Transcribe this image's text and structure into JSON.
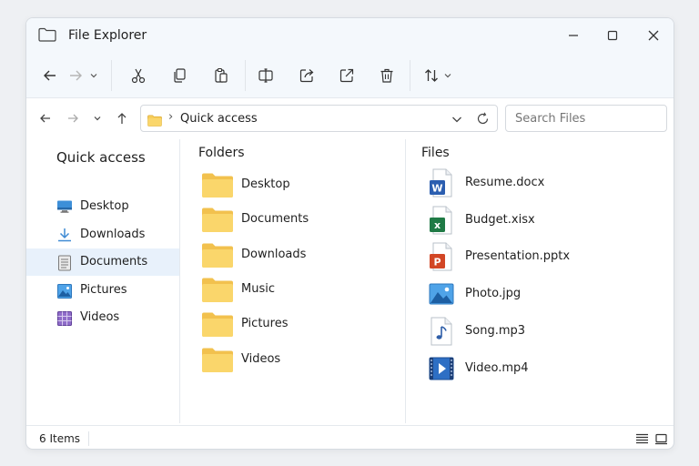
{
  "window": {
    "title": "File Explorer"
  },
  "address": {
    "crumb": "Quick access"
  },
  "search": {
    "placeholder": "Search Files"
  },
  "sidebar": {
    "heading": "Quick access",
    "items": [
      {
        "label": "Desktop",
        "icon": "desktop-icon"
      },
      {
        "label": "Downloads",
        "icon": "download-icon"
      },
      {
        "label": "Documents",
        "icon": "document-icon",
        "selected": true
      },
      {
        "label": "Pictures",
        "icon": "picture-icon"
      },
      {
        "label": "Videos",
        "icon": "video-icon"
      }
    ]
  },
  "folders": {
    "title": "Folders",
    "items": [
      "Desktop",
      "Documents",
      "Downloads",
      "Music",
      "Pictures",
      "Videos"
    ]
  },
  "files": {
    "title": "Files",
    "items": [
      {
        "label": "Resume.docx",
        "icon": "word-icon",
        "badge": "W"
      },
      {
        "label": "Budget.xisx",
        "icon": "excel-icon",
        "badge": "x"
      },
      {
        "label": "Presentation.pptx",
        "icon": "powerpoint-icon",
        "badge": "P"
      },
      {
        "label": "Photo.jpg",
        "icon": "image-icon"
      },
      {
        "label": "Song.mp3",
        "icon": "audio-icon"
      },
      {
        "label": "Video.mp4",
        "icon": "video-file-icon"
      }
    ]
  },
  "status": {
    "count": "6 Items"
  },
  "colors": {
    "accent": "#2f7fd6",
    "folder": "#f7cd5a",
    "word": "#2b5eb0",
    "excel": "#1f7a45",
    "powerpoint": "#d24625",
    "selected_bg": "#e8f1fb"
  }
}
